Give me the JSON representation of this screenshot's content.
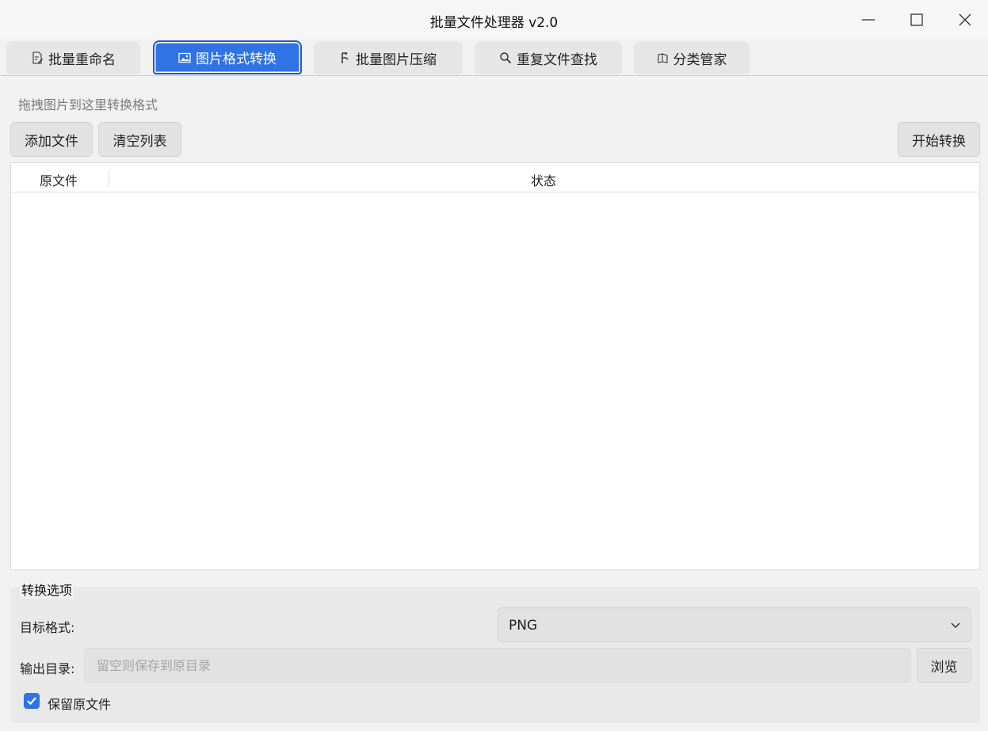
{
  "window": {
    "title": "批量文件处理器 v2.0"
  },
  "tabs": [
    {
      "label": "批量重命名",
      "icon": "document-edit-icon",
      "active": false
    },
    {
      "label": "图片格式转换",
      "icon": "image-icon",
      "active": true
    },
    {
      "label": "批量图片压缩",
      "icon": "compress-icon",
      "active": false
    },
    {
      "label": "重复文件查找",
      "icon": "search-icon",
      "active": false
    },
    {
      "label": "分类管家",
      "icon": "folder-icon",
      "active": false
    }
  ],
  "convert": {
    "hint": "拖拽图片到这里转换格式",
    "add_files_label": "添加文件",
    "clear_list_label": "清空列表",
    "start_label": "开始转换",
    "table": {
      "columns": [
        "原文件",
        "状态"
      ],
      "rows": []
    },
    "options": {
      "title": "转换选项",
      "format_label": "目标格式:",
      "format_value": "PNG",
      "output_label": "输出目录:",
      "output_value": "",
      "output_placeholder": "留空则保存到原目录",
      "browse_label": "浏览",
      "keep_original_label": "保留原文件",
      "keep_original_checked": true
    }
  },
  "colors": {
    "accent": "#2f73e4",
    "background": "#f1f1f1",
    "button": "#e2e2e2"
  }
}
